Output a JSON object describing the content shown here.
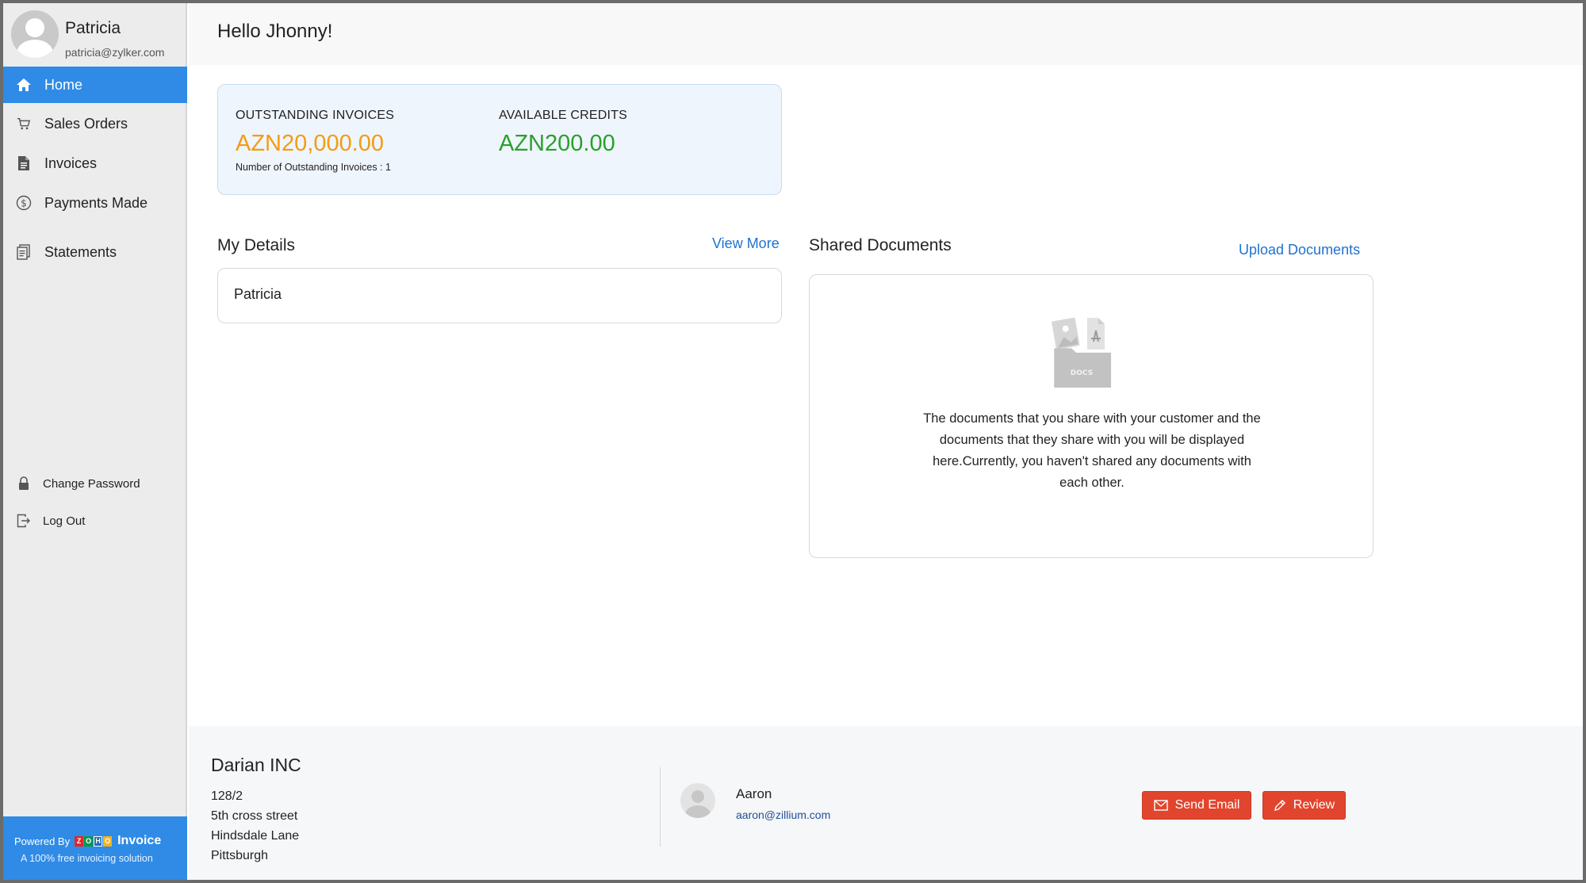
{
  "profile": {
    "name": "Patricia",
    "email": "patricia@zylker.com"
  },
  "nav": {
    "home": "Home",
    "sales_orders": "Sales Orders",
    "invoices": "Invoices",
    "payments_made": "Payments Made",
    "statements": "Statements",
    "change_password": "Change Password",
    "log_out": "Log Out"
  },
  "powered": {
    "prefix": "Powered By",
    "zoho_letters": [
      "Z",
      "O",
      "H",
      "O"
    ],
    "product": "Invoice",
    "tagline": "A 100% free invoicing solution"
  },
  "greeting": "Hello Jhonny!",
  "summary": {
    "outstanding_label": "OUTSTANDING INVOICES",
    "outstanding_value": "AZN20,000.00",
    "outstanding_count": "Number of Outstanding Invoices : 1",
    "credits_label": "AVAILABLE CREDITS",
    "credits_value": "AZN200.00"
  },
  "my_details": {
    "title": "My Details",
    "view_more": "View More",
    "name": "Patricia"
  },
  "shared_documents": {
    "title": "Shared Documents",
    "upload": "Upload Documents",
    "folder_label": "DOCS",
    "empty_message": "The documents that you share with your customer and the documents that they share with you will be displayed here.Currently, you haven't shared any documents with each other."
  },
  "footer": {
    "org_name": "Darian INC",
    "address": [
      "128/2",
      "5th cross street",
      "Hindsdale Lane",
      "Pittsburgh"
    ],
    "contact_name": "Aaron",
    "contact_email": "aaron@zillium.com",
    "send_email": "Send Email",
    "review": "Review"
  },
  "colors": {
    "accent": "#2f8be6",
    "outstanding": "#f39c12",
    "credits": "#2aa02a",
    "link": "#1f72d1",
    "button": "#e2452d"
  }
}
